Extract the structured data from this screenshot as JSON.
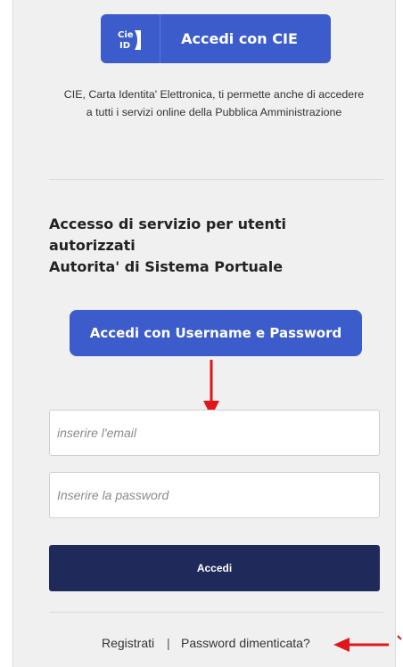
{
  "cie": {
    "button_label": "Accedi con CIE",
    "logo_text": "Cie ID",
    "description": "CIE, Carta Identita' Elettronica, ti permette anche di accedere a tutti i servizi online della Pubblica Amministrazione"
  },
  "access": {
    "heading_line1": "Accesso di servizio per utenti autorizzati",
    "heading_line2": "Autorita' di Sistema Portuale",
    "userpass_button_label": "Accedi con Username e Password"
  },
  "form": {
    "email_placeholder": "inserire l'email",
    "email_value": "",
    "password_placeholder": "Inserire la password",
    "password_value": "",
    "submit_label": "Accedi"
  },
  "footer": {
    "register_label": "Registrati",
    "separator": "|",
    "forgot_label": "Password dimenticata?"
  },
  "colors": {
    "accent_blue": "#3c5ccb",
    "dark_navy": "#1f2a5a",
    "annotation_red": "#e0161a"
  },
  "icons": {
    "cie_logo": "cie-id-logo-icon",
    "annotation_down": "red-arrow-down-icon",
    "annotation_left": "red-arrow-left-icon"
  }
}
